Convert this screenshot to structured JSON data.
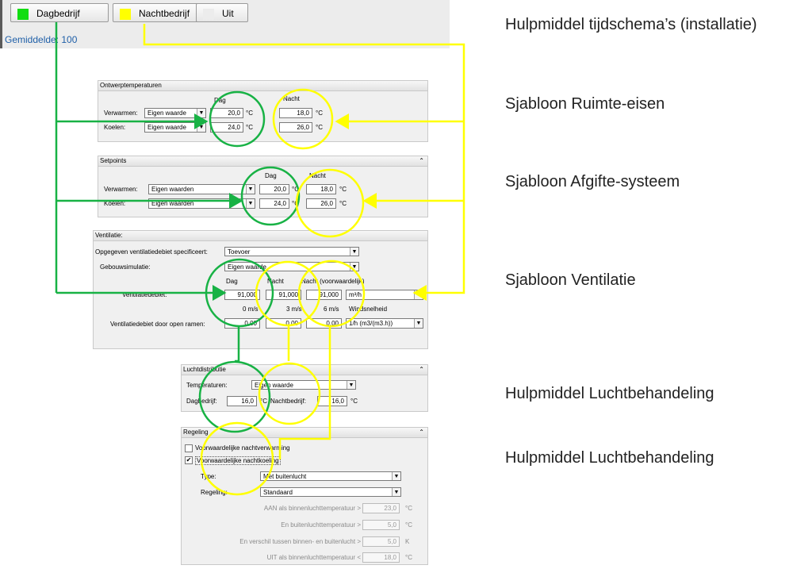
{
  "toolbar": {
    "day_label": "Dagbedrijf",
    "night_label": "Nachtbedrijf",
    "off_label": "Uit",
    "average": "Gemiddelde: 100"
  },
  "colors": {
    "day": "#18b245",
    "night": "#ffff00",
    "day_swatch": "#11dd11",
    "night_swatch": "#ffff00"
  },
  "side_labels": [
    "Hulpmiddel tijdschema’s (installatie)",
    "Sjabloon Ruimte-eisen",
    "Sjabloon Afgifte-systeem",
    "Sjabloon Ventilatie",
    "Hulpmiddel Luchtbehandeling",
    "Hulpmiddel Luchtbehandeling"
  ],
  "ontwerp": {
    "title": "Ontwerptemperaturen",
    "col_day": "Dag",
    "col_night": "Nacht",
    "rows": [
      {
        "label": "Verwarmen:",
        "select": "Eigen waarde",
        "day": "20,0",
        "night": "18,0",
        "unit1": "°C",
        "unit2": "°C"
      },
      {
        "label": "Koelen:",
        "select": "Eigen waarde",
        "day": "24,0",
        "night": "26,0",
        "unit1": "°C",
        "unit2": "°C"
      }
    ]
  },
  "setpoints": {
    "title": "Setpoints",
    "collapse": "⌃",
    "col_day": "Dag",
    "col_night": "Nacht",
    "rows": [
      {
        "label": "Verwarmen:",
        "select": "Eigen waarden",
        "day": "20,0",
        "night": "18,0",
        "unit1": "°C",
        "unit2": "°C"
      },
      {
        "label": "Koelen:",
        "select": "Eigen waarden",
        "day": "24,0",
        "night": "26,0",
        "unit1": "°C",
        "unit2": "°C"
      }
    ]
  },
  "ventilatie": {
    "title": "Ventilatie:",
    "spec_label": "Opgegeven ventilatiedebiet specificeert:",
    "spec_value": "Toevoer",
    "sim_label": "Gebouwsimulatie:",
    "sim_value": "Eigen waarde",
    "col_day": "Dag",
    "col_night": "Nacht",
    "col_cond": "Nacht (voorwaardelijk)",
    "debiet_label": "Ventilatiedebiet:",
    "debiet_day": "91,000",
    "debiet_night": "91,000",
    "debiet_cond": "91,000",
    "debiet_unit": "m³/h",
    "wind_0": "0 m/s",
    "wind_3": "3 m/s",
    "wind_6": "6 m/s",
    "wind_label": "Windsnelheid",
    "open_label": "Ventilatiedebiet door open ramen:",
    "open_0": "0,00",
    "open_3": "0,00",
    "open_6": "0,00",
    "open_unit": "1/h (m3/(m3.h))"
  },
  "lucht": {
    "title": "Luchtdistributie",
    "collapse": "⌃",
    "temp_label": "Temperaturen:",
    "temp_value": "Eigen waarde",
    "day_label": "Dagbedrijf:",
    "day_value": "16,0",
    "night_label": "Nachtbedrijf:",
    "night_value": "16,0",
    "unit": "°C"
  },
  "regeling": {
    "title": "Regeling",
    "collapse": "⌃",
    "cb1_label": "Voorwaardelijke nachtverwarming",
    "cb1_checked": false,
    "cb2_label": "Voorwaardelijke nachtkoeling",
    "cb2_checked": true,
    "check_mark": "✔",
    "type_label": "Type:",
    "type_value": "Met buitenlucht",
    "reg_label": "Regeling:",
    "reg_value": "Standaard",
    "rows": [
      {
        "label": "AAN als binnenluchttemperatuur >",
        "value": "23,0",
        "unit": "°C"
      },
      {
        "label": "En buitenluchttemperatuur >",
        "value": "5,0",
        "unit": "°C"
      },
      {
        "label": "En verschil tussen binnen- en buitenlucht >",
        "value": "5,0",
        "unit": "K"
      },
      {
        "label": "UIT als binnenluchttemperatuur <",
        "value": "18,0",
        "unit": "°C"
      }
    ]
  },
  "dropdown_arrow": "▼"
}
